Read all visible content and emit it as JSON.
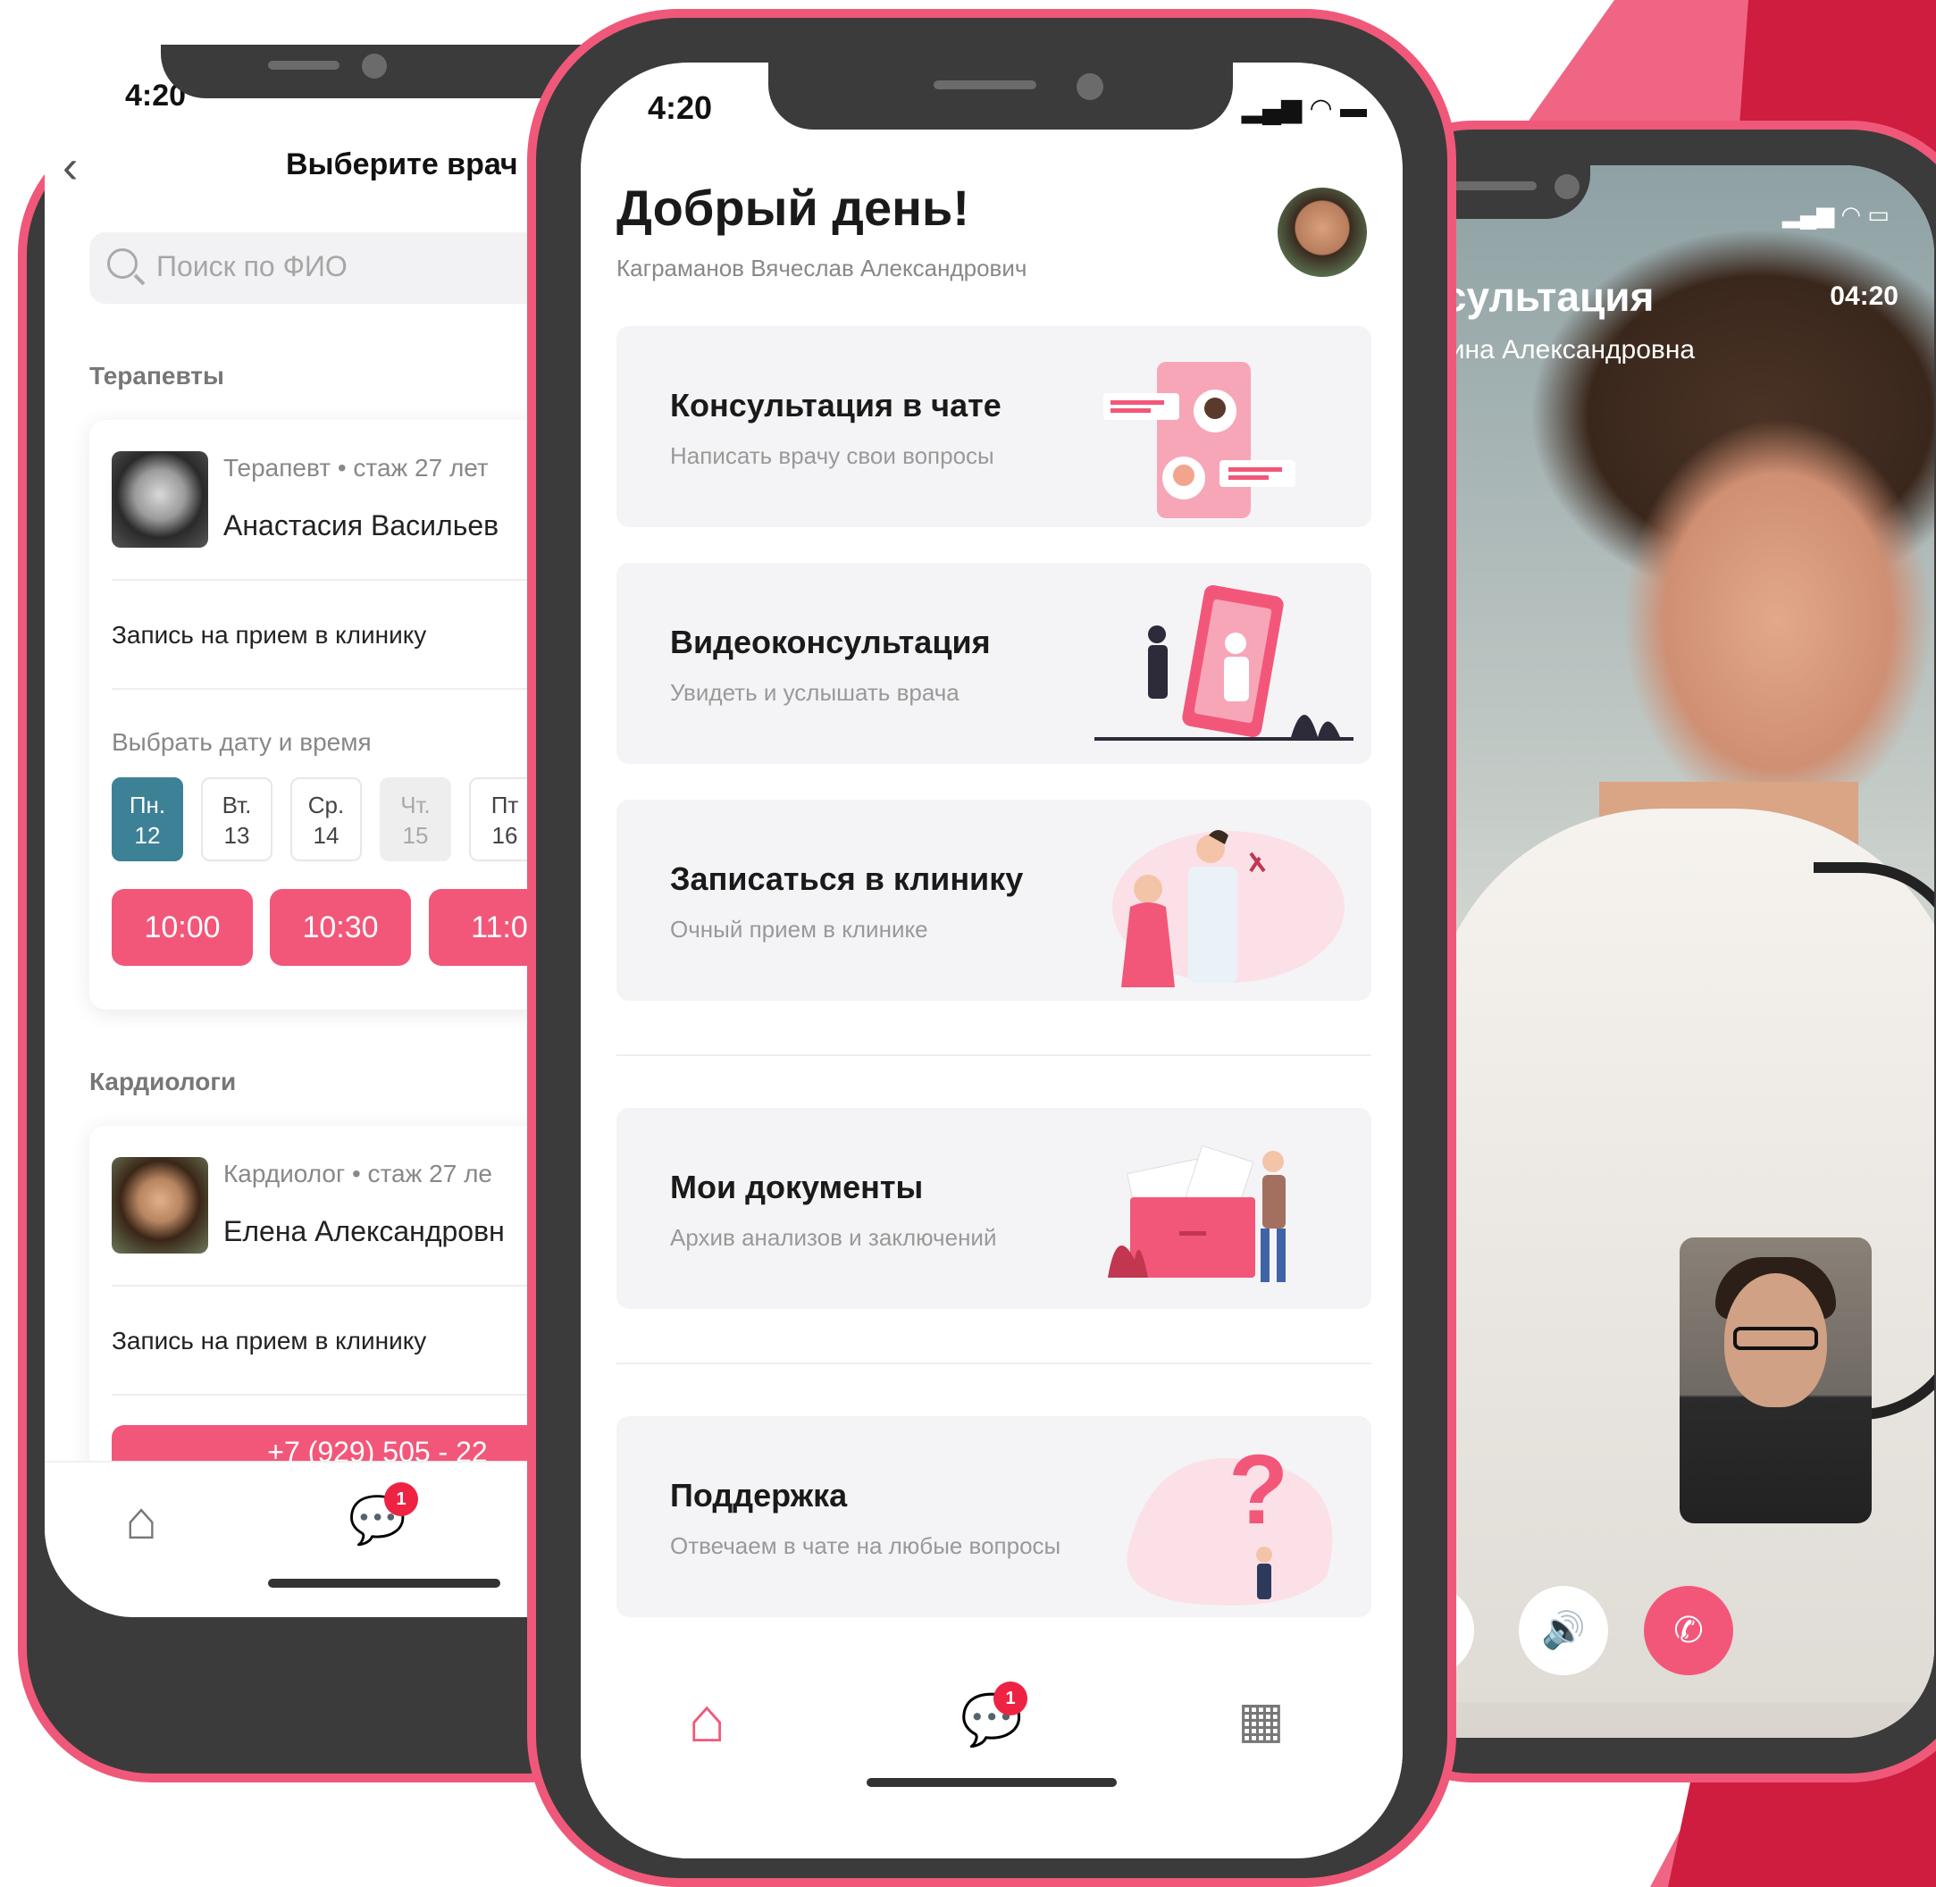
{
  "left_screen": {
    "time": "4:20",
    "title": "Выберите врач",
    "search_placeholder": "Поиск по ФИО",
    "sections": [
      {
        "title": "Терапевты",
        "doctor": {
          "specialty": "Терапевт • стаж 27 лет",
          "name": "Анастасия Васильев"
        },
        "clinic_link": "Запись на прием в клинику",
        "choose_label": "Выбрать дату и время",
        "days": [
          {
            "weekday": "Пн.",
            "date": "12"
          },
          {
            "weekday": "Вт.",
            "date": "13"
          },
          {
            "weekday": "Ср.",
            "date": "14"
          },
          {
            "weekday": "Чт.",
            "date": "15"
          },
          {
            "weekday": "Пт",
            "date": "16"
          }
        ],
        "times": [
          "10:00",
          "10:30",
          "11:0"
        ]
      },
      {
        "title": "Кардиологи",
        "doctor": {
          "specialty": "Кардиолог • стаж 27 ле",
          "name": "Елена Александровн"
        },
        "clinic_link": "Запись на прием в клинику",
        "phone_button": "+7 (929) 505 - 22"
      }
    ],
    "badge_count": "1",
    "icons": [
      "home-icon",
      "chat-icon"
    ]
  },
  "center_screen": {
    "time": "4:20",
    "greeting": "Добрый день!",
    "user_name": "Каграманов Вячеслав Александрович",
    "cards": [
      {
        "title": "Консультация в чате",
        "subtitle": "Написать врачу свои вопросы"
      },
      {
        "title": "Видеоконсультация",
        "subtitle": "Увидеть и услышать врача"
      },
      {
        "title": "Записаться в клинику",
        "subtitle": "Очный прием в клинике"
      },
      {
        "title": "Мои документы",
        "subtitle": "Архив анализов и заключений"
      },
      {
        "title": "Поддержка",
        "subtitle": "Отвечаем в чате на любые вопросы"
      }
    ],
    "badge_count": "1",
    "icons": [
      "home-icon",
      "chat-icon",
      "calendar-icon"
    ],
    "accent_color": "#f2577a"
  },
  "right_screen": {
    "title": "онсультация",
    "timer": "04:20",
    "doctor_name": "атерина Александровна",
    "icons": [
      "microphone-icon",
      "speaker-icon",
      "end-call-icon"
    ]
  }
}
